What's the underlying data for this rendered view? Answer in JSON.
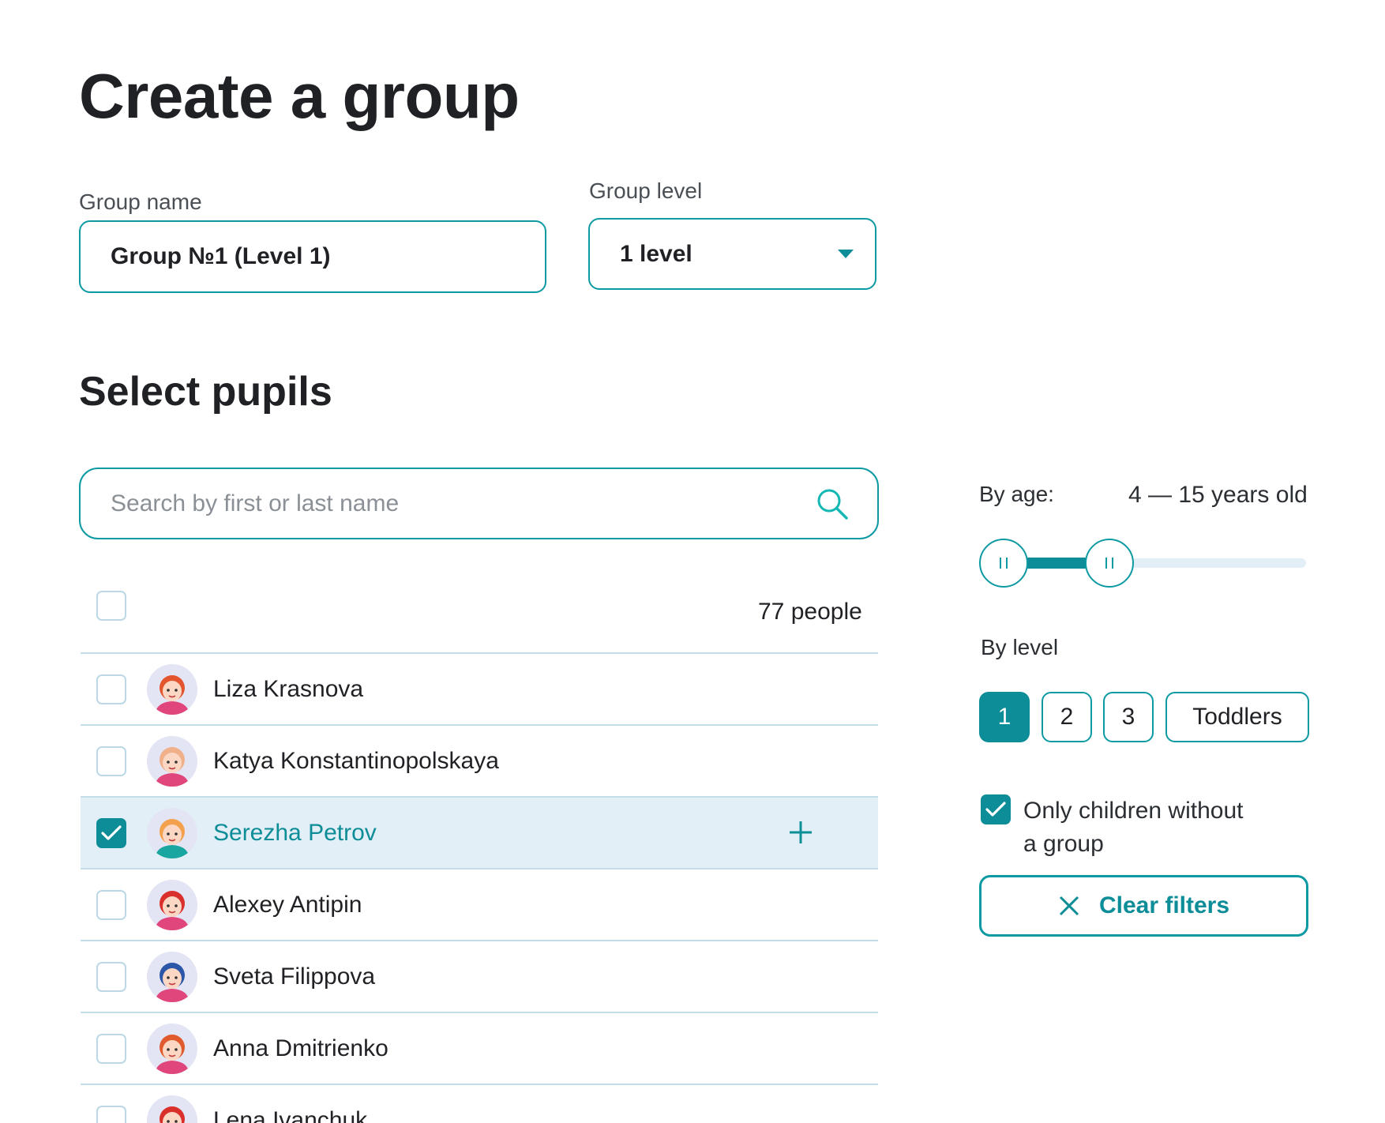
{
  "page": {
    "title": "Create a group"
  },
  "group_name": {
    "label": "Group name",
    "value": "Group №1 (Level 1)"
  },
  "group_level": {
    "label": "Group level",
    "value": "1 level"
  },
  "pupils": {
    "title": "Select pupils",
    "search_placeholder": "Search by first or last name",
    "count": "77 people",
    "items": [
      {
        "name": "Liza Krasnova",
        "checked": false,
        "hair": "#e2552f"
      },
      {
        "name": "Katya Konstantinopolskaya",
        "checked": false,
        "hair": "#f0b08a"
      },
      {
        "name": "Serezha Petrov",
        "checked": true,
        "hair": "#f3a14d"
      },
      {
        "name": "Alexey Antipin",
        "checked": false,
        "hair": "#d9302c"
      },
      {
        "name": "Sveta Filippova",
        "checked": false,
        "hair": "#2c56a8"
      },
      {
        "name": "Anna Dmitrienko",
        "checked": false,
        "hair": "#e05a2e"
      },
      {
        "name": "Lena Ivanchuk",
        "checked": false,
        "hair": "#d9302c"
      }
    ]
  },
  "filters": {
    "age": {
      "label": "By age:",
      "value_text": "4 — 15 years old",
      "range_fraction": [
        0.0,
        0.38
      ]
    },
    "level": {
      "label": "By level",
      "options": [
        "1",
        "2",
        "3",
        "Toddlers"
      ],
      "selected": "1"
    },
    "only_without_group": {
      "label_line1": "Only children without",
      "label_line2": "a group",
      "checked": true
    },
    "clear_label": "Clear filters"
  },
  "colors": {
    "accent": "#0d9aa3",
    "accent_dark": "#0d8d97",
    "row_selected": "#e2eff6",
    "divider": "#c4dce8"
  }
}
